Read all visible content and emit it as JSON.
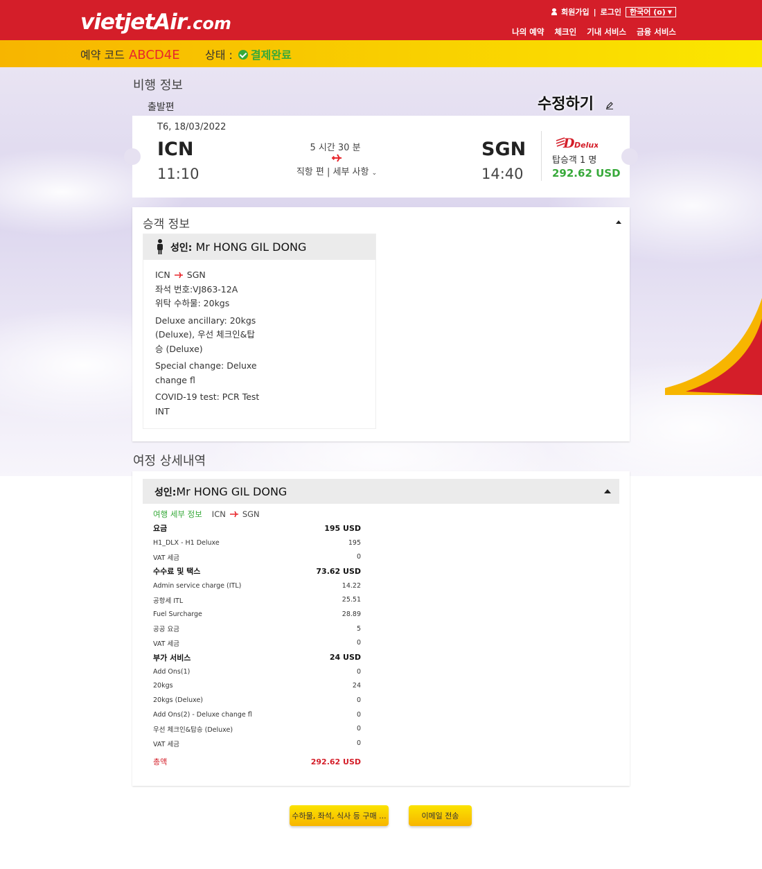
{
  "header": {
    "logo": "vietjetAir",
    "logo_suffix": ".com",
    "signup": "회원가입",
    "login": "로그인",
    "language": "한국어 (o)",
    "nav": [
      "나의 예약",
      "체크인",
      "기내 서비스",
      "금융 서비스"
    ]
  },
  "booking": {
    "code_label": "예약 코드",
    "code": "ABCD4E",
    "status_label": "상태 :",
    "status": "결제완료"
  },
  "flight_section": {
    "title": "비행 정보",
    "leg_label": "출발편",
    "edit_label": "수정하기",
    "date": "T6, 18/03/2022",
    "from": "ICN",
    "departure_time": "11:10",
    "duration": "5 시간 30 분",
    "detail": "직항 편 | 세부 사항",
    "to": "SGN",
    "arrival_time": "14:40",
    "fare_class": "Deluxe",
    "passengers": "탑승객 1 명",
    "price": "292.62 USD"
  },
  "passenger_section": {
    "title": "승객 정보",
    "pax_type": "성인:",
    "pax_name": "Mr HONG GIL DONG",
    "route_from": "ICN",
    "route_to": "SGN",
    "seat": "좌석 번호:VJ863-12A",
    "baggage": "위탁 수하물: 20kgs",
    "ancillary_1": "Deluxe ancillary: 20kgs",
    "ancillary_2": "(Deluxe), 우선 체크인&탑",
    "ancillary_3": "승 (Deluxe)",
    "special_1": "Special change: Deluxe",
    "special_2": "change fl",
    "covid_1": "COVID-19 test: PCR Test",
    "covid_2": "INT"
  },
  "itinerary_section": {
    "title": "여정 상세내역",
    "pax_type": "성인:",
    "pax_name": "Mr HONG GIL DONG",
    "trip_label": "여행 세부 정보",
    "route_from": "ICN",
    "route_to": "SGN",
    "rows": [
      {
        "label": "요금",
        "value": "195 USD",
        "bold": true
      },
      {
        "label": "H1_DLX - H1 Deluxe",
        "value": "195"
      },
      {
        "label": "VAT 세금",
        "value": "0"
      },
      {
        "label": "수수료 및 택스",
        "value": "73.62 USD",
        "bold": true
      },
      {
        "label": "Admin service charge (ITL)",
        "value": "14.22"
      },
      {
        "label": "공항세 ITL",
        "value": "25.51"
      },
      {
        "label": "Fuel Surcharge",
        "value": "28.89"
      },
      {
        "label": "공공 요금",
        "value": "5"
      },
      {
        "label": "VAT 세금",
        "value": "0"
      },
      {
        "label": "부가 서비스",
        "value": "24 USD",
        "bold": true
      },
      {
        "label": "Add Ons(1)",
        "value": "0"
      },
      {
        "label": "20kgs",
        "value": "24"
      },
      {
        "label": "20kgs (Deluxe)",
        "value": "0"
      },
      {
        "label": "Add Ons(2) - Deluxe change fl",
        "value": "0"
      },
      {
        "label": "우선 체크인&탑승 (Deluxe)",
        "value": "0"
      },
      {
        "label": "VAT 세금",
        "value": "0"
      }
    ],
    "total_label": "총액",
    "total_value": "292.62 USD"
  },
  "actions": {
    "extras_button": "수하물, 좌석, 식사 등 구매 ...",
    "email_button": "이메일 전송"
  },
  "colors": {
    "brand_red": "#d41e29",
    "brand_yellow": "#f9d000",
    "success_green": "#37a93a"
  }
}
